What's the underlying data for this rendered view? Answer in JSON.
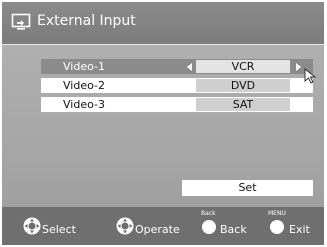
{
  "title": "External Input",
  "rows": [
    {
      "name": "Video-1",
      "value": "VCR"
    },
    {
      "name": "Video-2",
      "value": "DVD"
    },
    {
      "name": "Video-3",
      "value": "SAT"
    }
  ],
  "set_label": "Set",
  "footer": {
    "select": "Select",
    "operate": "Operate",
    "back_small": "Back",
    "back": "Back",
    "menu_small": "MENU",
    "exit": "Exit"
  },
  "icons": {
    "title": "input-screen-icon",
    "select": "dpad-icon",
    "operate": "dpad-icon",
    "back": "round-button-icon",
    "exit": "round-button-icon",
    "cursor": "mouse-pointer-icon"
  },
  "colors": {
    "title_bar": "#7c7c7c",
    "panel": "#a6a6a6",
    "selected_row": "#8b8b8b",
    "value_box": "#cfcfcf",
    "footer": "#6f6f6f"
  }
}
